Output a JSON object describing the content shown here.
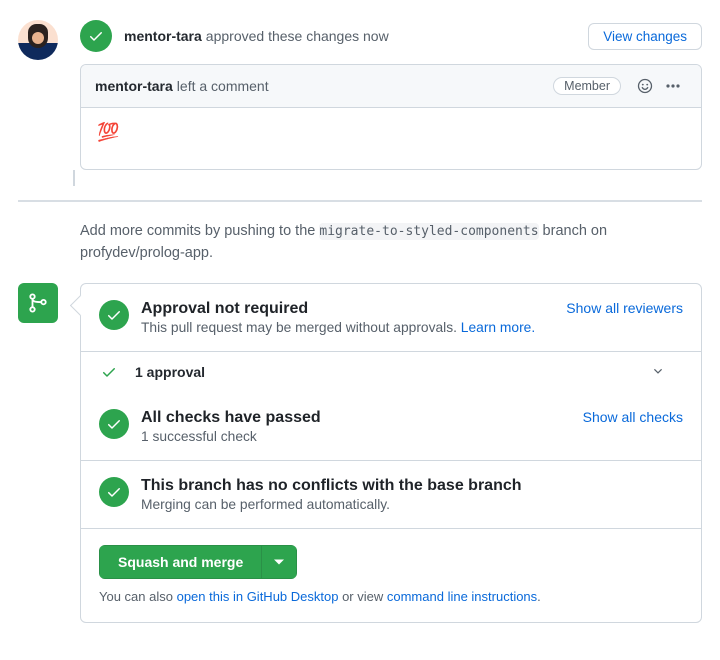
{
  "review": {
    "author": "mentor-tara",
    "action_text": "approved these changes now",
    "view_changes_label": "View changes"
  },
  "comment": {
    "author": "mentor-tara",
    "action_text": "left a comment",
    "member_badge": "Member",
    "body": "💯"
  },
  "push_hint": {
    "prefix": "Add more commits by pushing to the ",
    "branch": "migrate-to-styled-components",
    "middle": " branch on ",
    "repo": "profydev/prolog-app",
    "suffix": "."
  },
  "merge": {
    "approval": {
      "title": "Approval not required",
      "subtitle_prefix": "This pull request may be merged without approvals. ",
      "learn_more": "Learn more.",
      "show_all_reviewers": "Show all reviewers",
      "count_label": "1 approval"
    },
    "checks": {
      "title": "All checks have passed",
      "subtitle": "1 successful check",
      "show_all_checks": "Show all checks"
    },
    "conflicts": {
      "title": "This branch has no conflicts with the base branch",
      "subtitle": "Merging can be performed automatically."
    },
    "action": {
      "button_label": "Squash and merge",
      "hint_prefix": "You can also ",
      "hint_link1": "open this in GitHub Desktop",
      "hint_middle": " or view ",
      "hint_link2": "command line instructions",
      "hint_suffix": "."
    }
  }
}
